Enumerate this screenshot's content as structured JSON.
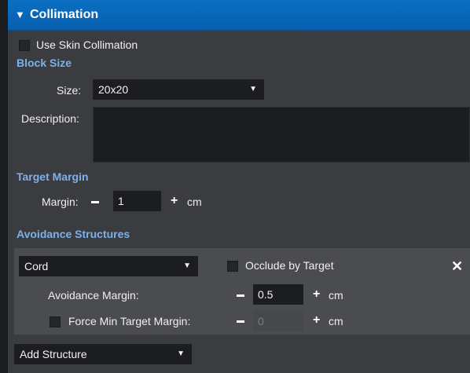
{
  "header": {
    "collapse_glyph": "▼",
    "title": "Collimation"
  },
  "skin": {
    "label": "Use Skin Collimation"
  },
  "block_size": {
    "section_title": "Block Size",
    "size_label": "Size:",
    "size_value": "20x20",
    "description_label": "Description:"
  },
  "target_margin": {
    "section_title": "Target Margin",
    "margin_label": "Margin:",
    "minus": "−",
    "value": "1",
    "plus": "+",
    "unit": "cm"
  },
  "avoidance": {
    "section_title": "Avoidance Structures",
    "structure_value": "Cord",
    "occlude_label": "Occlude by Target",
    "remove_glyph": "✕",
    "avoid_margin_label": "Avoidance Margin:",
    "avoid_margin_value": "0.5",
    "avoid_unit": "cm",
    "force_label": "Force Min Target Margin:",
    "force_value": "0",
    "force_unit": "cm",
    "plus": "+",
    "add_structure": "Add Structure"
  },
  "colors": {
    "header": "#0b6fc2",
    "section_title": "#7fb0e8",
    "panel": "#3a3c40",
    "input_bg": "#1c1d20"
  },
  "icons": {
    "collapse": "triangle-down-icon",
    "dropdown": "caret-down-icon",
    "remove": "close-icon"
  }
}
